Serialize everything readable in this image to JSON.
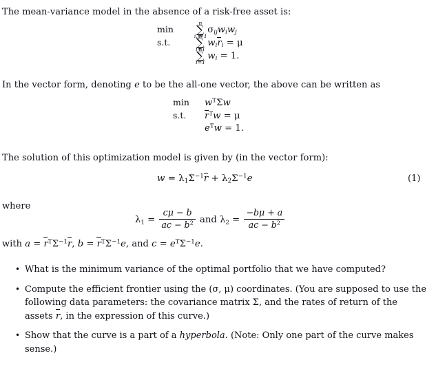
{
  "document": {
    "intro_paragraph": "The mean-variance model in the absence of a risk-free asset is:",
    "vector_form_paragraph_pre": "In the vector form, denoting ",
    "vector_form_italic_e": "e",
    "vector_form_paragraph_post": " to be the all-one vector, the above can be written as",
    "solution_paragraph": "The solution of this optimization model is given by (in the vector form):",
    "where_label": "where",
    "equation_number": "(1)"
  },
  "model_scalar": {
    "objective_label": "min",
    "constraint_label": "s.t.",
    "objective": {
      "sum_upper": "n",
      "sum_lower": "i,j=1",
      "body_sigma": "σ",
      "body_sigma_sub": "ij",
      "body_w1": "w",
      "body_w1_sub": "i",
      "body_w2": "w",
      "body_w2_sub": "j"
    },
    "constraint1": {
      "sum_upper": "n",
      "sum_lower": "i=1",
      "w": "w",
      "w_sub": "i",
      "rbar": "r",
      "rbar_sub": "i",
      "equals": "=",
      "mu": "μ"
    },
    "constraint2": {
      "sum_upper": "n",
      "sum_lower": "i=1",
      "w": "w",
      "w_sub": "i",
      "equals": "=",
      "value": "1."
    }
  },
  "model_vector": {
    "objective_label": "min",
    "constraint_label": "s.t.",
    "objective": {
      "w": "w",
      "transpose": "T",
      "Sigma": "Σ",
      "w2": "w"
    },
    "constraint1": {
      "rbar": "r",
      "transpose": "T",
      "w": "w",
      "equals": "=",
      "mu": "μ"
    },
    "constraint2": {
      "e": "e",
      "transpose": "T",
      "w": "w",
      "equals": "=",
      "value": "1."
    }
  },
  "solution_equation": {
    "w": "w",
    "equals": "=",
    "lambda1": "λ",
    "lambda1_sub": "1",
    "Sigma": "Σ",
    "inv": "−1",
    "rbar": "r",
    "plus": "+",
    "lambda2": "λ",
    "lambda2_sub": "2",
    "Sigma2": "Σ",
    "inv2": "−1",
    "e": "e"
  },
  "lambda_definitions": {
    "lambda1": "λ",
    "lambda1_sub": "1",
    "equals1": "=",
    "frac1_numerator": "cμ − b",
    "frac1_denominator_pre": "ac − b",
    "frac1_denominator_sup": "2",
    "conjunction": "and",
    "lambda2": "λ",
    "lambda2_sub": "2",
    "equals2": "=",
    "frac2_numerator": "−bμ + a",
    "frac2_denominator_pre": "ac − b",
    "frac2_denominator_sup": "2"
  },
  "abc_line": {
    "with": "with ",
    "a": "a",
    "eq1": " = ",
    "rbar1": "r",
    "T1": "T",
    "Sigma1": "Σ",
    "inv1": "−1",
    "rbar2": "r",
    "comma1": ", ",
    "b": "b",
    "eq2": " = ",
    "rbar3": "r",
    "T2": "T",
    "Sigma2": "Σ",
    "inv2": "−1",
    "e1": "e",
    "comma2": ", and ",
    "c": "c",
    "eq3": " = ",
    "e2": "e",
    "T3": "T",
    "Sigma3": "Σ",
    "inv3": "−1",
    "e3": "e",
    "period": "."
  },
  "questions": [
    {
      "bullet": "•",
      "text": "What is the minimum variance of the optimal portfolio that we have computed?"
    },
    {
      "bullet": "•",
      "text_part1": "Compute the efficient frontier using the (σ, μ) coordinates. (You are supposed to use the following data parameters: the covariance matrix Σ, and the rates of return of the assets ",
      "text_italic_rbar": "r",
      "text_part2": ", in the expression of this curve.)"
    },
    {
      "bullet": "•",
      "text_part1": "Show that the curve is a part of a ",
      "text_italic": "hyperbola",
      "text_part2": ". (Note: Only one part of the curve makes sense.)"
    }
  ],
  "colors": {
    "background": "#ffffff",
    "text": "#101018"
  }
}
